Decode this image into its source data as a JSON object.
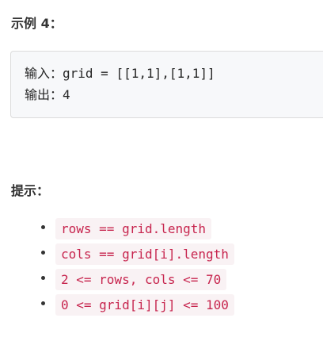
{
  "example": {
    "heading": "示例 4：",
    "input_label": "输入：",
    "input_value": "grid = [[1,1],[1,1]]",
    "output_label": "输出：",
    "output_value": "4"
  },
  "hints": {
    "heading": "提示：",
    "items": [
      "rows == grid.length",
      "cols == grid[i].length",
      "2 <= rows, cols <= 70",
      "0 <= grid[i][j] <= 100"
    ]
  },
  "colors": {
    "code_text": "#c7254e",
    "code_background": "#f9f2f4",
    "example_background": "#f7f8fa"
  }
}
